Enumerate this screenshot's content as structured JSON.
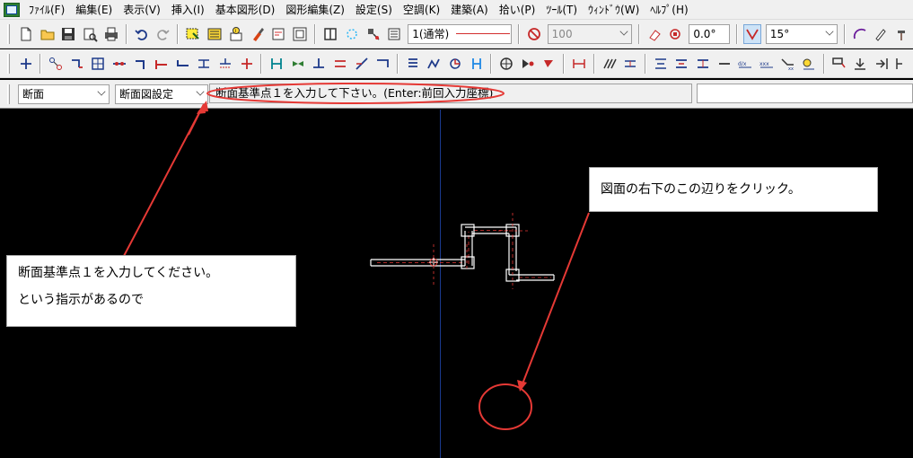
{
  "menu": {
    "items": [
      "ﾌｧｲﾙ(F)",
      "編集(E)",
      "表示(V)",
      "挿入(I)",
      "基本図形(D)",
      "図形編集(Z)",
      "設定(S)",
      "空調(K)",
      "建築(A)",
      "拾い(P)",
      "ﾂｰﾙ(T)",
      "ｳｨﾝﾄﾞｳ(W)",
      "ﾍﾙﾌﾟ(H)"
    ]
  },
  "toolbar1": {
    "layer_combo": "1(通常)",
    "color_combo": "100",
    "angle_value": "0.0°",
    "snap_angle": "15°"
  },
  "cmdbar": {
    "mode_combo": "断面",
    "settings_combo": "断面図設定",
    "prompt_text": "断面基準点１を入力して下さい。(Enter:前回入力座標)",
    "command_input": ""
  },
  "annotations": {
    "left_callout_line1": "断面基準点１を入力してください。",
    "left_callout_line2": "という指示があるので",
    "right_callout": "図面の右下のこの辺りをクリック。"
  },
  "colors": {
    "annotation_red": "#e53935",
    "canvas_bg": "#000000",
    "pipe_white": "#ffffff",
    "axis_blue": "#1a3a8f"
  }
}
